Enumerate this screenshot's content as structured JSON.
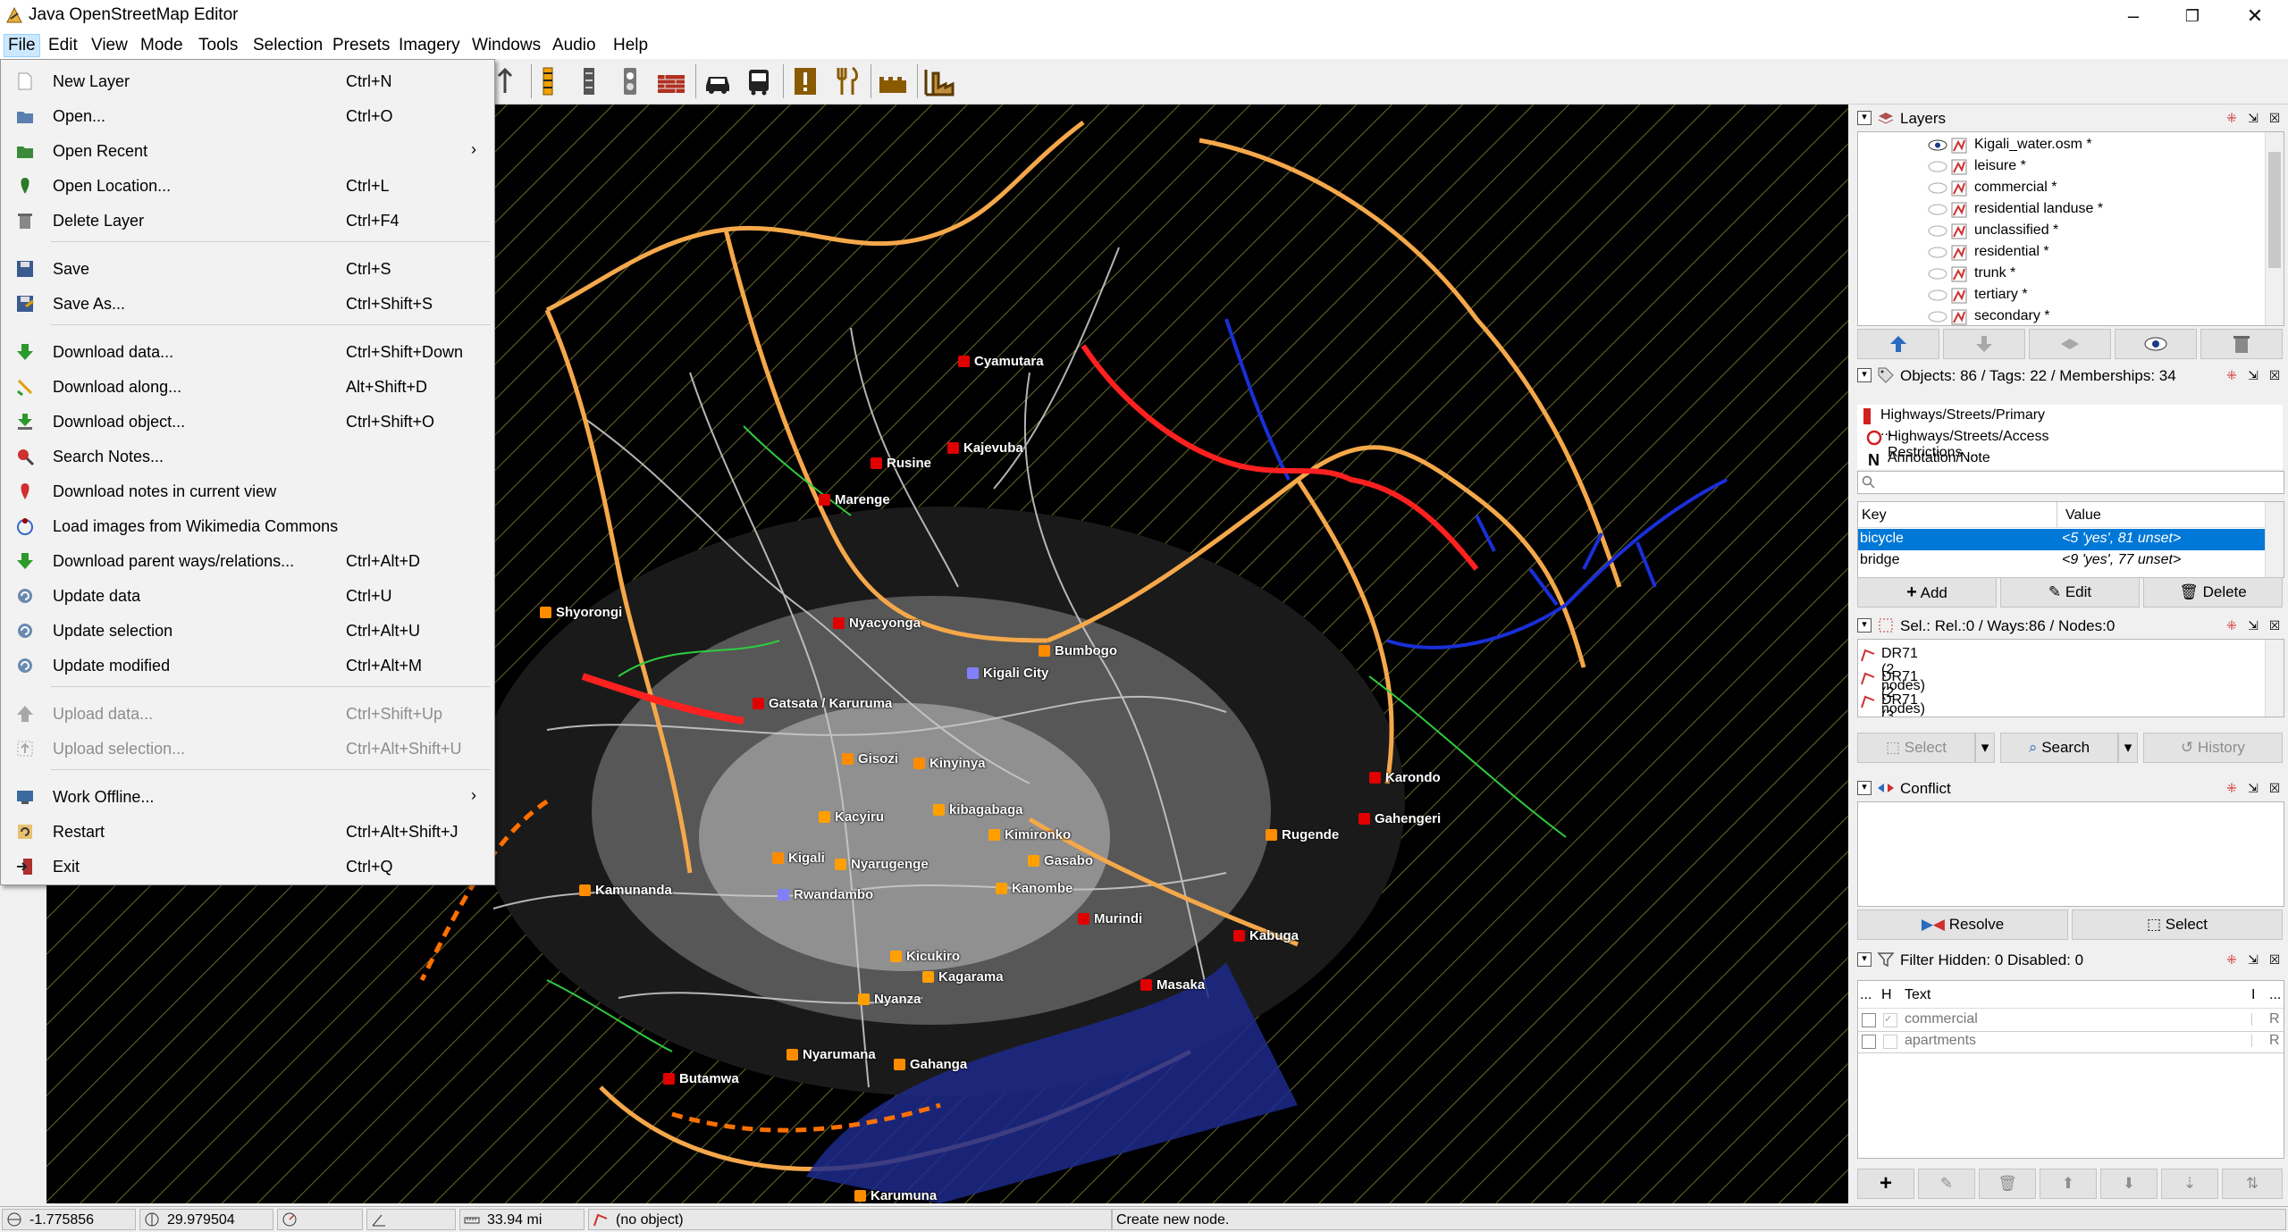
{
  "window": {
    "title": "Java OpenStreetMap Editor",
    "minimize_glyph": "–",
    "maximize_glyph": "❐",
    "close_glyph": "✕"
  },
  "menubar": [
    {
      "label": "File",
      "active": true
    },
    {
      "label": "Edit"
    },
    {
      "label": "View"
    },
    {
      "label": "Mode"
    },
    {
      "label": "Tools"
    },
    {
      "label": "Selection"
    },
    {
      "label": "Presets"
    },
    {
      "label": "Imagery"
    },
    {
      "label": "Windows"
    },
    {
      "label": "Audio"
    },
    {
      "label": "Help"
    }
  ],
  "toolbar": {
    "icons": [
      "upload-icon",
      "road-works-icon",
      "traffic-signal-icon",
      "crossing-icon",
      "wall-icon",
      "car-icon",
      "bus-icon",
      "attention-icon",
      "restaurant-icon",
      "castle-icon",
      "industrial-icon"
    ]
  },
  "file_menu": {
    "items": [
      {
        "label": "New Layer",
        "accel": "Ctrl+N",
        "icon": "new-layer-icon"
      },
      {
        "label": "Open...",
        "accel": "Ctrl+O",
        "icon": "open-icon"
      },
      {
        "label": "Open Recent",
        "accel": "",
        "icon": "open-recent-icon",
        "submenu": true
      },
      {
        "label": "Open Location...",
        "accel": "Ctrl+L",
        "icon": "open-location-icon"
      },
      {
        "label": "Delete Layer",
        "accel": "Ctrl+F4",
        "icon": "delete-layer-icon"
      },
      {
        "label": "Save",
        "accel": "Ctrl+S",
        "icon": "save-icon"
      },
      {
        "label": "Save As...",
        "accel": "Ctrl+Shift+S",
        "icon": "save-as-icon"
      },
      {
        "label": "Download data...",
        "accel": "Ctrl+Shift+Down",
        "icon": "download-icon"
      },
      {
        "label": "Download along...",
        "accel": "Alt+Shift+D",
        "icon": "download-along-icon"
      },
      {
        "label": "Download object...",
        "accel": "Ctrl+Shift+O",
        "icon": "download-object-icon"
      },
      {
        "label": "Search Notes...",
        "accel": "",
        "icon": "search-notes-icon"
      },
      {
        "label": "Download notes in current view",
        "accel": "",
        "icon": "download-notes-icon"
      },
      {
        "label": "Load images from Wikimedia Commons",
        "accel": "",
        "icon": "wikimedia-icon"
      },
      {
        "label": "Download parent ways/relations...",
        "accel": "Ctrl+Alt+D",
        "icon": "download-parent-icon"
      },
      {
        "label": "Update data",
        "accel": "Ctrl+U",
        "icon": "update-data-icon"
      },
      {
        "label": "Update selection",
        "accel": "Ctrl+Alt+U",
        "icon": "update-selection-icon"
      },
      {
        "label": "Update modified",
        "accel": "Ctrl+Alt+M",
        "icon": "update-modified-icon"
      },
      {
        "label": "Upload data...",
        "accel": "Ctrl+Shift+Up",
        "icon": "upload-data-icon",
        "disabled": true
      },
      {
        "label": "Upload selection...",
        "accel": "Ctrl+Alt+Shift+U",
        "icon": "upload-selection-icon",
        "disabled": true
      },
      {
        "label": "Work Offline...",
        "accel": "",
        "icon": "work-offline-icon",
        "submenu": true
      },
      {
        "label": "Restart",
        "accel": "Ctrl+Alt+Shift+J",
        "icon": "restart-icon"
      },
      {
        "label": "Exit",
        "accel": "Ctrl+Q",
        "icon": "exit-icon"
      }
    ],
    "submenu_glyph": "›"
  },
  "map": {
    "places": [
      {
        "name": "Cyamutara",
        "color": "#e00000"
      },
      {
        "name": "Kajevuba",
        "color": "#e00000"
      },
      {
        "name": "Rusine",
        "color": "#e00000"
      },
      {
        "name": "Marenge",
        "color": "#e00000"
      },
      {
        "name": "Shyorongi",
        "color": "#ff8c00"
      },
      {
        "name": "Nyacyonga",
        "color": "#e00000"
      },
      {
        "name": "Bumbogo",
        "color": "#ff8c00"
      },
      {
        "name": "Kigali City",
        "color": "#8080ff"
      },
      {
        "name": "Gatsata / Karuruma",
        "color": "#e00000"
      },
      {
        "name": "Gisozi",
        "color": "#ff8c00"
      },
      {
        "name": "Kinyinya",
        "color": "#ff8c00"
      },
      {
        "name": "kibagabaga",
        "color": "#ffa000"
      },
      {
        "name": "Kacyiru",
        "color": "#ffa000"
      },
      {
        "name": "Kimironko",
        "color": "#ffa000"
      },
      {
        "name": "Kigali",
        "color": "#ff8c00"
      },
      {
        "name": "Nyarugenge",
        "color": "#ffa000"
      },
      {
        "name": "Gasabo",
        "color": "#ffa000"
      },
      {
        "name": "Kanombe",
        "color": "#ffa000"
      },
      {
        "name": "Rwandambo",
        "color": "#8080ff"
      },
      {
        "name": "Kamunanda",
        "color": "#ff8c00"
      },
      {
        "name": "Murindi",
        "color": "#e00000"
      },
      {
        "name": "Kicukiro",
        "color": "#ffa000"
      },
      {
        "name": "Kagarama",
        "color": "#ffa000"
      },
      {
        "name": "Kabuga",
        "color": "#e00000"
      },
      {
        "name": "Nyanza",
        "color": "#ffa000"
      },
      {
        "name": "Masaka",
        "color": "#e00000"
      },
      {
        "name": "Nyarumana",
        "color": "#ff8c00"
      },
      {
        "name": "Gahanga",
        "color": "#ff8c00"
      },
      {
        "name": "Butamwa",
        "color": "#e00000"
      },
      {
        "name": "Karumuna",
        "color": "#ff8c00"
      },
      {
        "name": "Karondo",
        "color": "#e00000"
      },
      {
        "name": "Gahengeri",
        "color": "#e00000"
      },
      {
        "name": "Rugende",
        "color": "#ff8c00"
      }
    ]
  },
  "layers_panel": {
    "title": "Layers",
    "layers": [
      {
        "name": "Kigali_water.osm *",
        "visible": true
      },
      {
        "name": "leisure *"
      },
      {
        "name": "commercial *"
      },
      {
        "name": "residential landuse *"
      },
      {
        "name": "unclassified *"
      },
      {
        "name": "residential *"
      },
      {
        "name": "trunk *"
      },
      {
        "name": "tertiary *"
      },
      {
        "name": "secondary *"
      }
    ],
    "buttons": [
      "move-up-icon",
      "move-down-icon",
      "merge-layer-icon",
      "show-hide-icon",
      "delete-icon"
    ]
  },
  "tags_panel": {
    "title": "Objects: 86 / Tags: 22 / Memberships: 34",
    "presets": [
      {
        "label": "Highways/Streets/Primary ...",
        "icon": "primary-road-icon"
      },
      {
        "label": "Highways/Streets/Access Restrictions ...",
        "icon": "access-restriction-icon"
      },
      {
        "label": "Annotation/Note ...",
        "icon": "note-icon"
      }
    ],
    "search_placeholder": "",
    "col_key": "Key",
    "col_value": "Value",
    "rows": [
      {
        "key": "bicycle",
        "value": "<5 'yes', 81 unset>",
        "selected": true
      },
      {
        "key": "bridge",
        "value": "<9 'yes', 77 unset>"
      }
    ],
    "add_label": "Add",
    "edit_label": "Edit",
    "delete_label": "Delete"
  },
  "selection_panel": {
    "title": "Sel.: Rel.:0 / Ways:86 / Nodes:0",
    "items": [
      "DR71 (2 nodes)",
      "DR71 (2 nodes)",
      "DR71 (3 nodes)"
    ],
    "select_label": "Select",
    "search_label": "Search",
    "history_label": "History"
  },
  "conflict_panel": {
    "title": "Conflict",
    "resolve_label": "Resolve",
    "select_label": "Select"
  },
  "filter_panel": {
    "title": "Filter Hidden: 0 Disabled: 0",
    "col_dots": "...",
    "col_h": "H",
    "col_text": "Text",
    "col_i": "I",
    "col_more": "...",
    "rows": [
      {
        "text": "commercial",
        "mode": "R"
      },
      {
        "text": "apartments",
        "mode": "R"
      }
    ]
  },
  "statusbar": {
    "lat": "-1.775856",
    "lon": "29.979504",
    "heading": "",
    "angle": "",
    "distance": "33.94 mi",
    "object": "(no object)",
    "message": "Create new node."
  },
  "colors": {
    "map_bg": "#000000",
    "menu_highlight": "#cce8ff",
    "selection_blue": "#0078d7"
  }
}
